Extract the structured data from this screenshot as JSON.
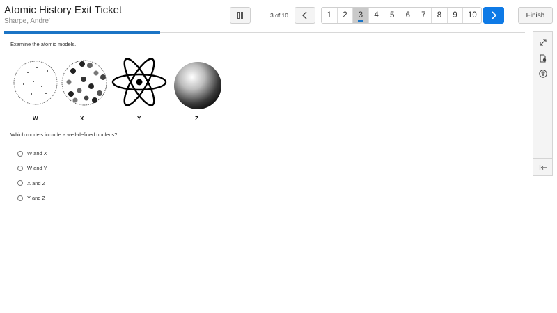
{
  "header": {
    "title": "Atomic History Exit Ticket",
    "student_name": "Sharpe, Andre'",
    "pause_icon": "pause-icon",
    "counter": "3 of 10",
    "prev_icon": "chevron-left-icon",
    "next_icon": "chevron-right-icon",
    "pages": [
      "1",
      "2",
      "3",
      "4",
      "5",
      "6",
      "7",
      "8",
      "9",
      "10"
    ],
    "active_page": "3",
    "finish_label": "Finish"
  },
  "progress": {
    "fraction": 0.3,
    "color": "#1b74c5"
  },
  "question": {
    "prompt": "Examine the atomic models.",
    "model_labels": [
      "W",
      "X",
      "Y",
      "Z"
    ],
    "text": "Which models include a well-defined nucleus?",
    "options": [
      "W and X",
      "W and Y",
      "X and Z",
      "Y and Z"
    ]
  },
  "side_tools": [
    "expand-icon",
    "line-reader-icon",
    "accessibility-icon",
    "collapse-panel-icon"
  ],
  "colors": {
    "accent": "#0e7ae6",
    "active_page_bg": "#c9c9c9"
  }
}
